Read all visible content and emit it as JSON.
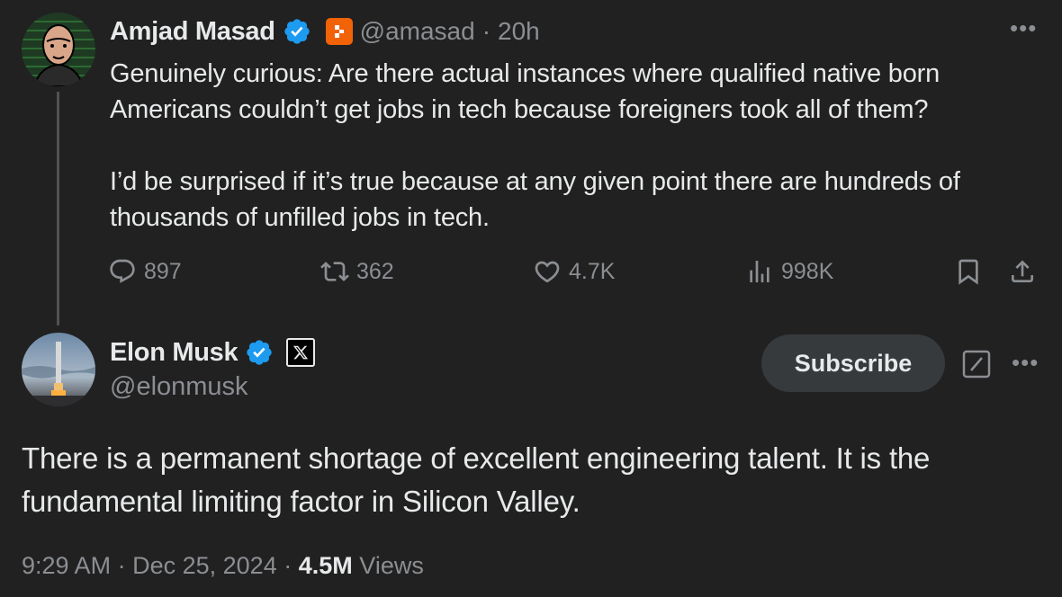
{
  "parent_tweet": {
    "author_name": "Amjad Masad",
    "handle": "@amasad",
    "separator": "·",
    "time": "20h",
    "avatar_icon": "cartoon-portrait-avatar",
    "affiliation_icon": "replit-logo-icon",
    "paragraphs": [
      "Genuinely curious: Are there actual instances where qualified native born Americans couldn’t get jobs in tech because foreigners took all of them?",
      "I’d be surprised if it’s true because at any given point there are hundreds of thousands of unfilled jobs in tech."
    ],
    "actions": {
      "replies": "897",
      "reposts": "362",
      "likes": "4.7K",
      "views": "998K"
    }
  },
  "main_tweet": {
    "author_name": "Elon Musk",
    "handle": "@elonmusk",
    "avatar_icon": "rocket-launch-avatar",
    "affiliation_icon": "x-logo-icon",
    "subscribe_label": "Subscribe",
    "text": "There is a permanent shortage of excellent engineering talent. It is the fundamental limiting factor in Silicon Valley.",
    "time": "9:29 AM",
    "separator1": "·",
    "date": "Dec 25, 2024",
    "separator2": "·",
    "views_count": "4.5M",
    "views_label": "Views"
  },
  "colors": {
    "background": "#212121",
    "text_primary": "#e7e9ea",
    "text_secondary": "#8b8e92",
    "verified_blue": "#1d9bf0",
    "subscribe_bg": "#363a3d",
    "replit_orange": "#f26207"
  }
}
